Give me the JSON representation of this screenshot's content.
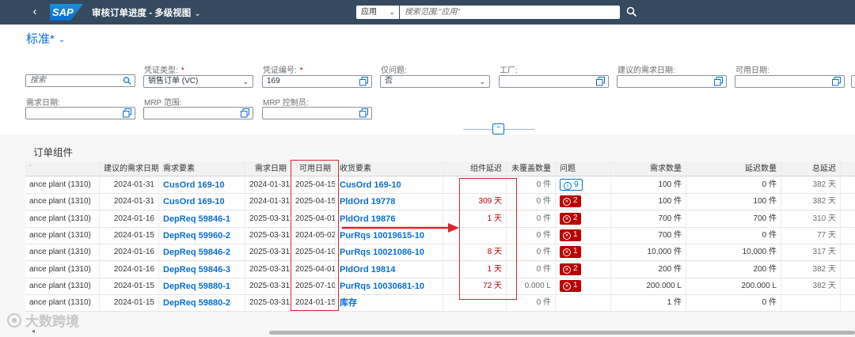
{
  "shell": {
    "title": "审核订单进度 - 多级视图",
    "logo": "SAP",
    "scope_value": "应用",
    "search_placeholder": "搜索范围:\"应用\""
  },
  "variant": {
    "label": "标准*"
  },
  "filters": {
    "search_placeholder": "搜索",
    "doc_type_label": "凭证类型:",
    "doc_type_value": "销售订单 (VC)",
    "doc_no_label": "凭证编号:",
    "doc_no_value": "169",
    "issues_only_label": "仅问题:",
    "issues_only_value": "否",
    "plant_label": "工厂:",
    "suggested_date_label": "建议的需求日期:",
    "avail_date_label": "可用日期:",
    "req_date_label": "需求日期:",
    "mrp_area_label": "MRP 范围:",
    "mrp_controller_label": "MRP 控制员:"
  },
  "section": {
    "title": "订单组件"
  },
  "table": {
    "columns": [
      "",
      "建议的需求日期",
      "需求要素",
      "需求日期",
      "可用日期",
      "收货要素",
      "组件延迟",
      "未覆盖数量",
      "问题",
      "需求数量",
      "延迟数量",
      "总延迟"
    ],
    "rows": [
      {
        "plant": "ance plant (1310)",
        "sug_date": "2024-01-31",
        "req_elem": "CusOrd 169-10",
        "req_date": "2024-01-31",
        "avail_date": "2025-04-15",
        "rcpt_elem": "CusOrd 169-10",
        "comp_delay": "",
        "uncovered": "0 件",
        "issue_type": "info",
        "issue_count": "9",
        "req_qty": "100 件",
        "delay_qty": "0 件",
        "total_delay": "382 天"
      },
      {
        "plant": "ance plant (1310)",
        "sug_date": "2024-01-31",
        "req_elem": "CusOrd 169-10",
        "req_date": "2024-01-31",
        "avail_date": "2025-04-15",
        "rcpt_elem": "PldOrd 19778",
        "comp_delay": "309 天",
        "uncovered": "0 件",
        "issue_type": "err",
        "issue_count": "2",
        "req_qty": "100 件",
        "delay_qty": "100 件",
        "total_delay": "382 天"
      },
      {
        "plant": "ance plant (1310)",
        "sug_date": "2024-01-16",
        "req_elem": "DepReq 59846-1",
        "req_date": "2025-03-31",
        "avail_date": "2025-04-01",
        "rcpt_elem": "PldOrd 19876",
        "comp_delay": "1 天",
        "uncovered": "0 件",
        "issue_type": "err",
        "issue_count": "2",
        "req_qty": "700 件",
        "delay_qty": "700 件",
        "total_delay": "310 天"
      },
      {
        "plant": "ance plant (1310)",
        "sug_date": "2024-01-15",
        "req_elem": "DepReq 59960-2",
        "req_date": "2025-03-31",
        "avail_date": "2024-05-02",
        "rcpt_elem": "PurRqs 10019615-10",
        "comp_delay": "",
        "uncovered": "0 件",
        "issue_type": "err",
        "issue_count": "1",
        "req_qty": "700 件",
        "delay_qty": "0 件",
        "total_delay": "77 天"
      },
      {
        "plant": "ance plant (1310)",
        "sug_date": "2024-01-16",
        "req_elem": "DepReq 59846-2",
        "req_date": "2025-03-31",
        "avail_date": "2025-04-10",
        "rcpt_elem": "PurRqs 10021086-10",
        "comp_delay": "8 天",
        "uncovered": "0 件",
        "issue_type": "err",
        "issue_count": "1",
        "req_qty": "10,000 件",
        "delay_qty": "10,000 件",
        "total_delay": "317 天"
      },
      {
        "plant": "ance plant (1310)",
        "sug_date": "2024-01-16",
        "req_elem": "DepReq 59846-3",
        "req_date": "2025-03-31",
        "avail_date": "2025-04-01",
        "rcpt_elem": "PldOrd 19814",
        "comp_delay": "1 天",
        "uncovered": "0 件",
        "issue_type": "err",
        "issue_count": "2",
        "req_qty": "200 件",
        "delay_qty": "200 件",
        "total_delay": "382 天"
      },
      {
        "plant": "ance plant (1310)",
        "sug_date": "2024-01-15",
        "req_elem": "DepReq 59880-1",
        "req_date": "2025-03-31",
        "avail_date": "2025-07-10",
        "rcpt_elem": "PurRqs 10030681-10",
        "comp_delay": "72 天",
        "uncovered": "0.000 L",
        "issue_type": "err",
        "issue_count": "1",
        "req_qty": "200.000 L",
        "delay_qty": "200.000 L",
        "total_delay": "382 天"
      },
      {
        "plant": "ance plant (1310)",
        "sug_date": "2024-01-15",
        "req_elem": "DepReq 59880-2",
        "req_date": "2025-03-31",
        "avail_date": "2024-01-15",
        "rcpt_elem": "库存",
        "comp_delay": "",
        "uncovered": "0 件",
        "issue_type": "",
        "issue_count": "",
        "req_qty": "1 件",
        "delay_qty": "0 件",
        "total_delay": ""
      }
    ]
  },
  "watermark": {
    "text": "大数跨境"
  },
  "colors": {
    "shell": "#354a5f",
    "link": "#0a6ed1",
    "error": "#bb0000",
    "annotation": "#d9262c"
  }
}
